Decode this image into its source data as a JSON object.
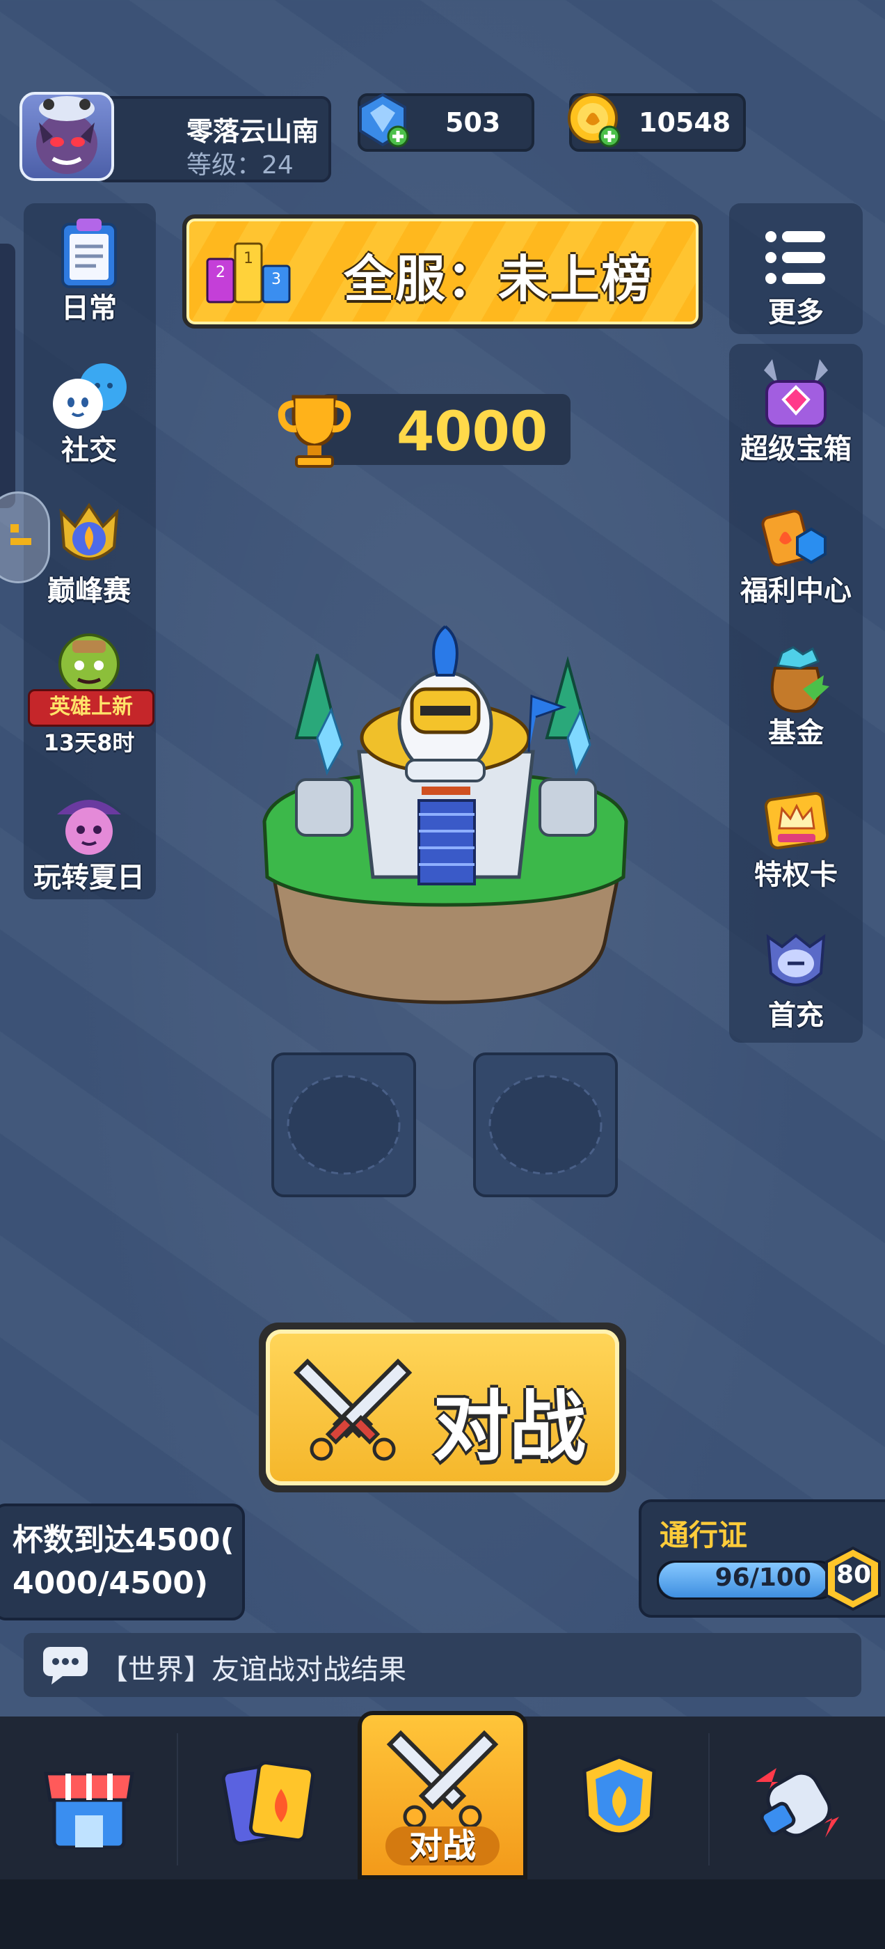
{
  "player": {
    "name": "零落云山南",
    "level_text": "等级：24"
  },
  "currency": {
    "gems": "503",
    "gold": "10548"
  },
  "ranking": {
    "label": "全服：未上榜",
    "podium": [
      "2",
      "1",
      "3"
    ]
  },
  "trophies": "4000",
  "left_menu": [
    {
      "label": "日常",
      "icon": "clipboard-icon"
    },
    {
      "label": "社交",
      "icon": "chat-bubbles-icon"
    },
    {
      "label": "巅峰赛",
      "icon": "crest-icon"
    },
    {
      "label": "13天8时",
      "icon": "hero-badge-icon",
      "badge": "英雄上新"
    },
    {
      "label": "玩转夏日",
      "icon": "summer-event-icon"
    }
  ],
  "right_menu": [
    {
      "label": "更多",
      "icon": "menu-list-icon"
    },
    {
      "label": "超级宝箱",
      "icon": "super-chest-icon"
    },
    {
      "label": "福利中心",
      "icon": "gift-cards-icon"
    },
    {
      "label": "基金",
      "icon": "fund-bag-icon"
    },
    {
      "label": "特权卡",
      "icon": "crown-card-icon"
    },
    {
      "label": "首充",
      "icon": "first-charge-icon"
    }
  ],
  "battle_button": "对战",
  "quest": {
    "line1": "杯数到达4500(",
    "line2": "4000/4500)"
  },
  "pass": {
    "title": "通行证",
    "progress_text": "96/100",
    "progress_value": 0.96,
    "level": "80"
  },
  "chat": {
    "message": "【世界】友谊战对战结果"
  },
  "bottom_nav": {
    "active_label": "对战",
    "items": [
      "shop-icon",
      "cards-icon",
      "battle-icon",
      "clan-shield-icon",
      "glove-icon"
    ]
  },
  "colors": {
    "background": "#3d5478",
    "accent_gold": "#ffc430",
    "trophy_text": "#ffd94a",
    "pass_fill": "#3f8fe0"
  }
}
